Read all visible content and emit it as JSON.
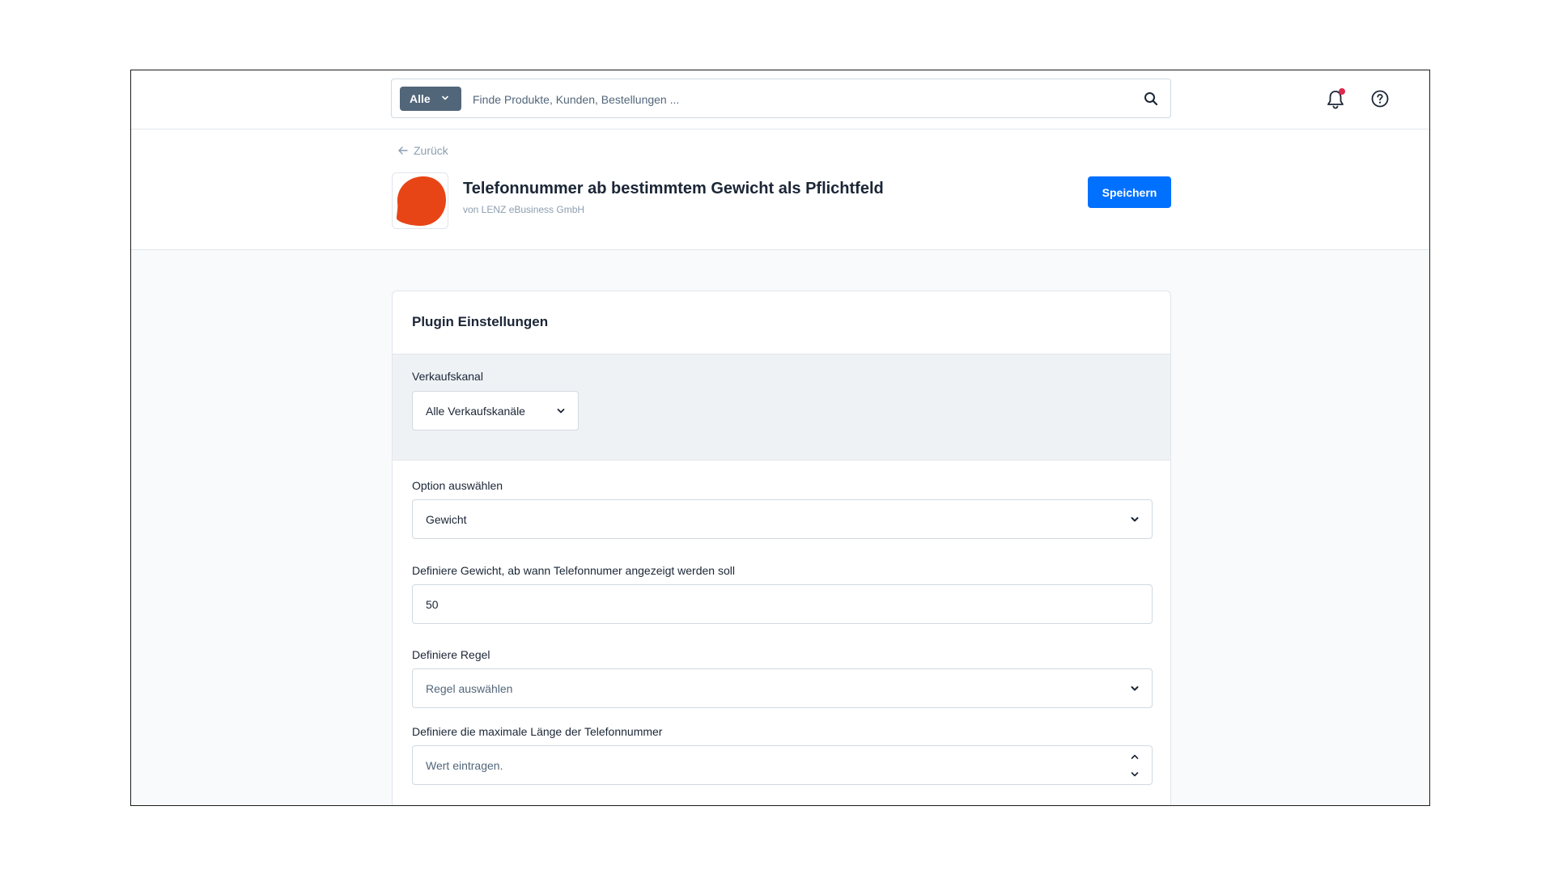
{
  "topbar": {
    "search_type": "Alle",
    "search_placeholder": "Finde Produkte, Kunden, Bestellungen ..."
  },
  "header": {
    "back_label": "Zurück",
    "title": "Telefonnummer ab bestimmtem Gewicht als Pflichtfeld",
    "vendor": "von LENZ eBusiness GmbH",
    "save_label": "Speichern"
  },
  "card": {
    "title": "Plugin Einstellungen",
    "sales_channel": {
      "label": "Verkaufskanal",
      "value": "Alle Verkaufskanäle"
    },
    "option": {
      "label": "Option auswählen",
      "value": "Gewicht"
    },
    "weight": {
      "label": "Definiere Gewicht, ab wann Telefonnumer angezeigt werden soll",
      "value": "50"
    },
    "rule": {
      "label": "Definiere Regel",
      "placeholder": "Regel auswählen"
    },
    "max_length": {
      "label": "Definiere die maximale Länge der Telefonnummer",
      "placeholder": "Wert eintragen."
    }
  },
  "colors": {
    "primary": "#0070ff",
    "logo": "#e84516",
    "notification": "#de294c",
    "search_type_bg": "#52667a"
  }
}
